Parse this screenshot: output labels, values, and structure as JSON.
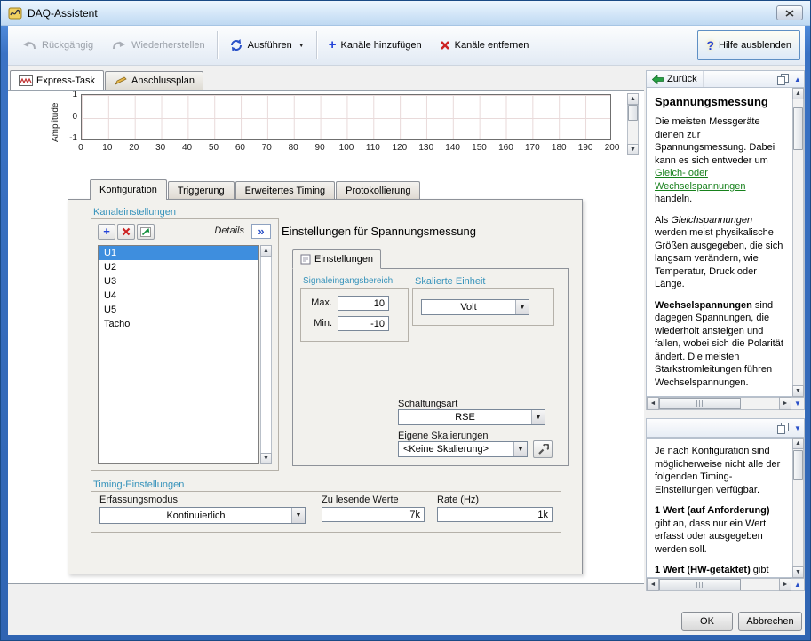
{
  "window": {
    "title": "DAQ-Assistent"
  },
  "toolbar": {
    "undo": "Rückgängig",
    "redo": "Wiederherstellen",
    "run": "Ausführen",
    "add_channels": "Kanäle hinzufügen",
    "remove_channels": "Kanäle entfernen",
    "hide_help": "Hilfe ausblenden"
  },
  "view_tabs": {
    "express": "Express-Task",
    "wiring": "Anschlussplan"
  },
  "chart": {
    "ylabel": "Amplitude",
    "yticks": [
      "1",
      "0",
      "-1"
    ],
    "xticks": [
      "0",
      "10",
      "20",
      "30",
      "40",
      "50",
      "60",
      "70",
      "80",
      "90",
      "100",
      "110",
      "120",
      "130",
      "140",
      "150",
      "160",
      "170",
      "180",
      "190",
      "200"
    ]
  },
  "config": {
    "tabs": [
      "Konfiguration",
      "Triggerung",
      "Erweitertes Timing",
      "Protokollierung"
    ],
    "channels": {
      "group_label": "Kanaleinstellungen",
      "details_label": "Details",
      "expand_label": "»",
      "items": [
        "U1",
        "U2",
        "U3",
        "U4",
        "U5",
        "Tacho"
      ]
    },
    "voltage": {
      "heading": "Einstellungen für Spannungsmessung",
      "tab": "Einstellungen",
      "range_group": "Signaleingangsbereich",
      "max_label": "Max.",
      "max_value": "10",
      "min_label": "Min.",
      "min_value": "-10",
      "unit_group": "Skalierte Einheit",
      "unit_value": "Volt",
      "terminal_label": "Schaltungsart",
      "terminal_value": "RSE",
      "scale_label": "Eigene Skalierungen",
      "scale_value": "<Keine Skalierung>"
    },
    "timing": {
      "group_label": "Timing-Einstellungen",
      "mode_label": "Erfassungsmodus",
      "mode_value": "Kontinuierlich",
      "samples_label": "Zu lesende Werte",
      "samples_value": "7k",
      "rate_label": "Rate (Hz)",
      "rate_value": "1k"
    }
  },
  "help": {
    "back_label": "Zurück",
    "title": "Spannungsmessung",
    "p1a": "Die meisten Messgeräte dienen zur Spannungsmessung. Dabei kann es sich entweder um ",
    "p1_link1": "Gleich- oder",
    "p1_link2": "Wechselspannungen",
    "p1b": " handeln.",
    "p2a": "Als ",
    "p2_em": "Gleichspannungen",
    "p2b": " werden meist physikalische Größen ausgegeben, die sich langsam verändern, wie Temperatur, Druck oder Länge.",
    "p3_em": "Wechselspannungen",
    "p3b": " sind dagegen Spannungen, die wiederholt ansteigen und fallen, wobei sich die Polarität ändert. Die meisten Starkstromleitungen führen Wechselspannungen."
  },
  "help2": {
    "p1": "Je nach Konfiguration sind möglicherweise nicht alle der folgenden Timing-Einstellungen verfügbar.",
    "p2_strong": "1 Wert (auf Anforderung)",
    "p2b": " gibt an, dass nur ein Wert erfasst oder ausgegeben werden soll.",
    "p3_strong": "1 Wert (HW-getaktet)",
    "p3b": " gibt an, dass ein Wert erfasst wird."
  },
  "footer": {
    "ok": "OK",
    "cancel": "Abbrechen"
  }
}
